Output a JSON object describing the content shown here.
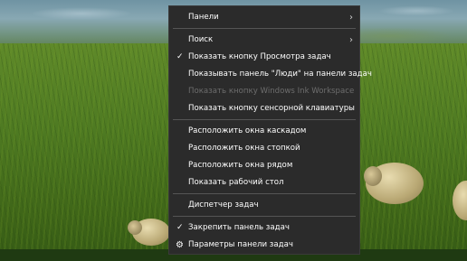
{
  "context_menu": {
    "items": [
      {
        "label": "Панели",
        "submenu": true
      },
      {
        "label": "Поиск",
        "submenu": true
      },
      {
        "label": "Показать кнопку Просмотра задач",
        "checked": true
      },
      {
        "label": "Показывать панель \"Люди\" на панели задач"
      },
      {
        "label": "Показать кнопку Windows Ink Workspace",
        "disabled": true
      },
      {
        "label": "Показать кнопку сенсорной клавиатуры"
      },
      {
        "label": "Расположить окна каскадом"
      },
      {
        "label": "Расположить окна стопкой"
      },
      {
        "label": "Расположить окна рядом"
      },
      {
        "label": "Показать рабочий стол"
      },
      {
        "label": "Диспетчер задач"
      },
      {
        "label": "Закрепить панель задач",
        "checked": true
      },
      {
        "label": "Параметры панели задач",
        "icon": "gear-icon"
      }
    ]
  },
  "icons": {
    "chevron": "›",
    "check": "✓",
    "gear": "⚙"
  }
}
